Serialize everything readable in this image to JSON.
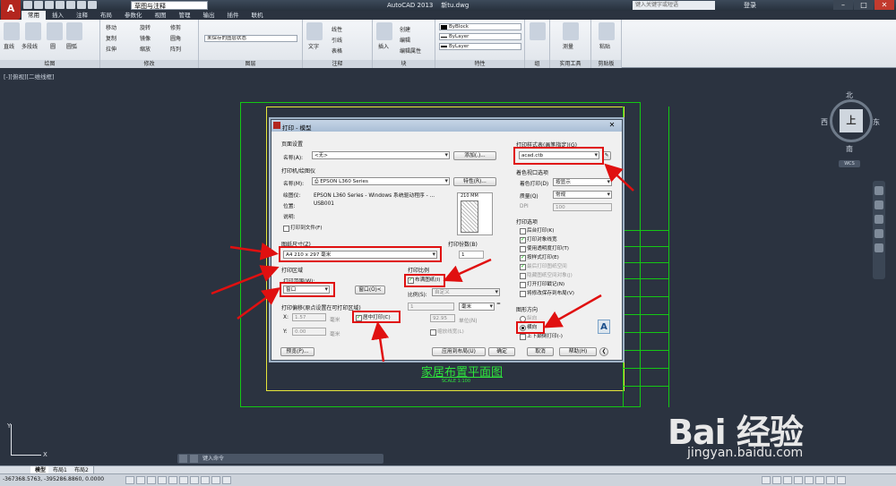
{
  "app": {
    "title": "AutoCAD 2013",
    "file": "新tu.dwg",
    "workspace": "草图与注释",
    "search_placeholder": "键入关键字或短语",
    "login": "登录",
    "tabs": [
      "常用",
      "插入",
      "注释",
      "布局",
      "参数化",
      "视图",
      "管理",
      "输出",
      "插件",
      "联机"
    ]
  },
  "ribbon": {
    "groups": [
      {
        "name": "绘图",
        "items": [
          "直线",
          "多段线",
          "圆",
          "圆弧"
        ]
      },
      {
        "name": "修改",
        "items": [
          "移动",
          "旋转",
          "修剪",
          "复制",
          "镜像",
          "圆角",
          "拉伸",
          "缩放",
          "阵列"
        ]
      },
      {
        "name": "图层",
        "items": [
          "未保存的图层状态"
        ]
      },
      {
        "name": "注释",
        "items": [
          "文字",
          "线性",
          "引线",
          "表格"
        ]
      },
      {
        "name": "块",
        "items": [
          "插入",
          "创建",
          "编辑",
          "编辑属性"
        ]
      },
      {
        "name": "特性",
        "items": [
          "ByBlock",
          "ByLayer",
          "ByLayer"
        ]
      },
      {
        "name": "组",
        "items": [
          "组"
        ]
      },
      {
        "name": "实用工具",
        "items": [
          "测量"
        ]
      },
      {
        "name": "剪贴板",
        "items": [
          "粘贴"
        ]
      }
    ]
  },
  "viewport_label": "[-][俯视][二维线框]",
  "viewcube": {
    "north": "北",
    "south": "南",
    "east": "东",
    "west": "西",
    "face": "上",
    "wcs": "WCS"
  },
  "drawing": {
    "title": "家居布置平面图",
    "scale": "SCALE 1:100"
  },
  "command_line": {
    "placeholder": "键入命令"
  },
  "layout_tabs": [
    "模型",
    "布局1",
    "布局2"
  ],
  "status": {
    "coords": "-367368.5763, -395286.8860, 0.0000"
  },
  "watermark": {
    "logo": "Bai 经验",
    "url": "jingyan.baidu.com"
  },
  "dialog": {
    "title": "打印 - 模型",
    "page_setup": {
      "section": "页面设置",
      "name_label": "名称(A):",
      "name_value": "<无>",
      "add_button": "添加(.)..."
    },
    "printer": {
      "section": "打印机/绘图仪",
      "name_label": "名称(M):",
      "name_value": "EPSON L360 Series",
      "properties_button": "特性(R)...",
      "plotter_label": "绘图仪:",
      "plotter_value": "EPSON L360 Series - Windows 系统驱动程序 - ...",
      "location_label": "位置:",
      "location_value": "USB001",
      "description_label": "说明:",
      "plot_to_file": "打印到文件(F)",
      "preview_dims": "210 MM"
    },
    "paper_size": {
      "section": "图纸尺寸(Z)",
      "value": "A4 210 x 297 毫米"
    },
    "copies": {
      "label": "打印份数(B)",
      "value": "1"
    },
    "plot_area": {
      "section": "打印区域",
      "what_label": "打印范围(W):",
      "what_value": "窗口",
      "window_button": "窗口(O)<"
    },
    "plot_scale": {
      "section": "打印比例",
      "fit": "布满图纸(I)",
      "scale_label": "比例(S):",
      "scale_value": "自定义",
      "v1": "1",
      "unit": "毫米",
      "eq": "=",
      "v2": "92.95",
      "unit2": "单位(N)",
      "lineweights": "缩放线宽(L)"
    },
    "plot_offset": {
      "section": "打印偏移(原点设置在可打印区域)",
      "x_label": "X:",
      "x_value": "1.57",
      "y_label": "Y:",
      "y_value": "0.00",
      "unit": "毫米",
      "center": "居中打印(C)"
    },
    "style_table": {
      "section": "打印样式表(画笔指定)(G)",
      "value": "acad.ctb"
    },
    "shaded": {
      "section": "着色视口选项",
      "shade_label": "着色打印(D)",
      "shade_value": "按显示",
      "quality_label": "质量(Q)",
      "quality_value": "常规",
      "dpi_label": "DPI",
      "dpi_value": "100"
    },
    "options": {
      "section": "打印选项",
      "items": [
        {
          "label": "后台打印(K)",
          "checked": false,
          "disabled": false
        },
        {
          "label": "打印对象线宽",
          "checked": true,
          "disabled": false
        },
        {
          "label": "使用透明度打印(T)",
          "checked": false,
          "disabled": false
        },
        {
          "label": "按样式打印(E)",
          "checked": true,
          "disabled": false
        },
        {
          "label": "最后打印图纸空间",
          "checked": true,
          "disabled": true
        },
        {
          "label": "隐藏图纸空间对象(J)",
          "checked": false,
          "disabled": true
        },
        {
          "label": "打开打印戳记(N)",
          "checked": false,
          "disabled": false
        },
        {
          "label": "将修改保存到布局(V)",
          "checked": false,
          "disabled": false
        }
      ]
    },
    "orientation": {
      "section": "图形方向",
      "portrait": "纵向",
      "landscape": "横向",
      "upside_down": "上下颠倒打印(-)"
    },
    "buttons": {
      "preview": "预览(P)...",
      "apply": "应用到布局(U)",
      "ok": "确定",
      "cancel": "取消",
      "help": "帮助(H)"
    }
  }
}
